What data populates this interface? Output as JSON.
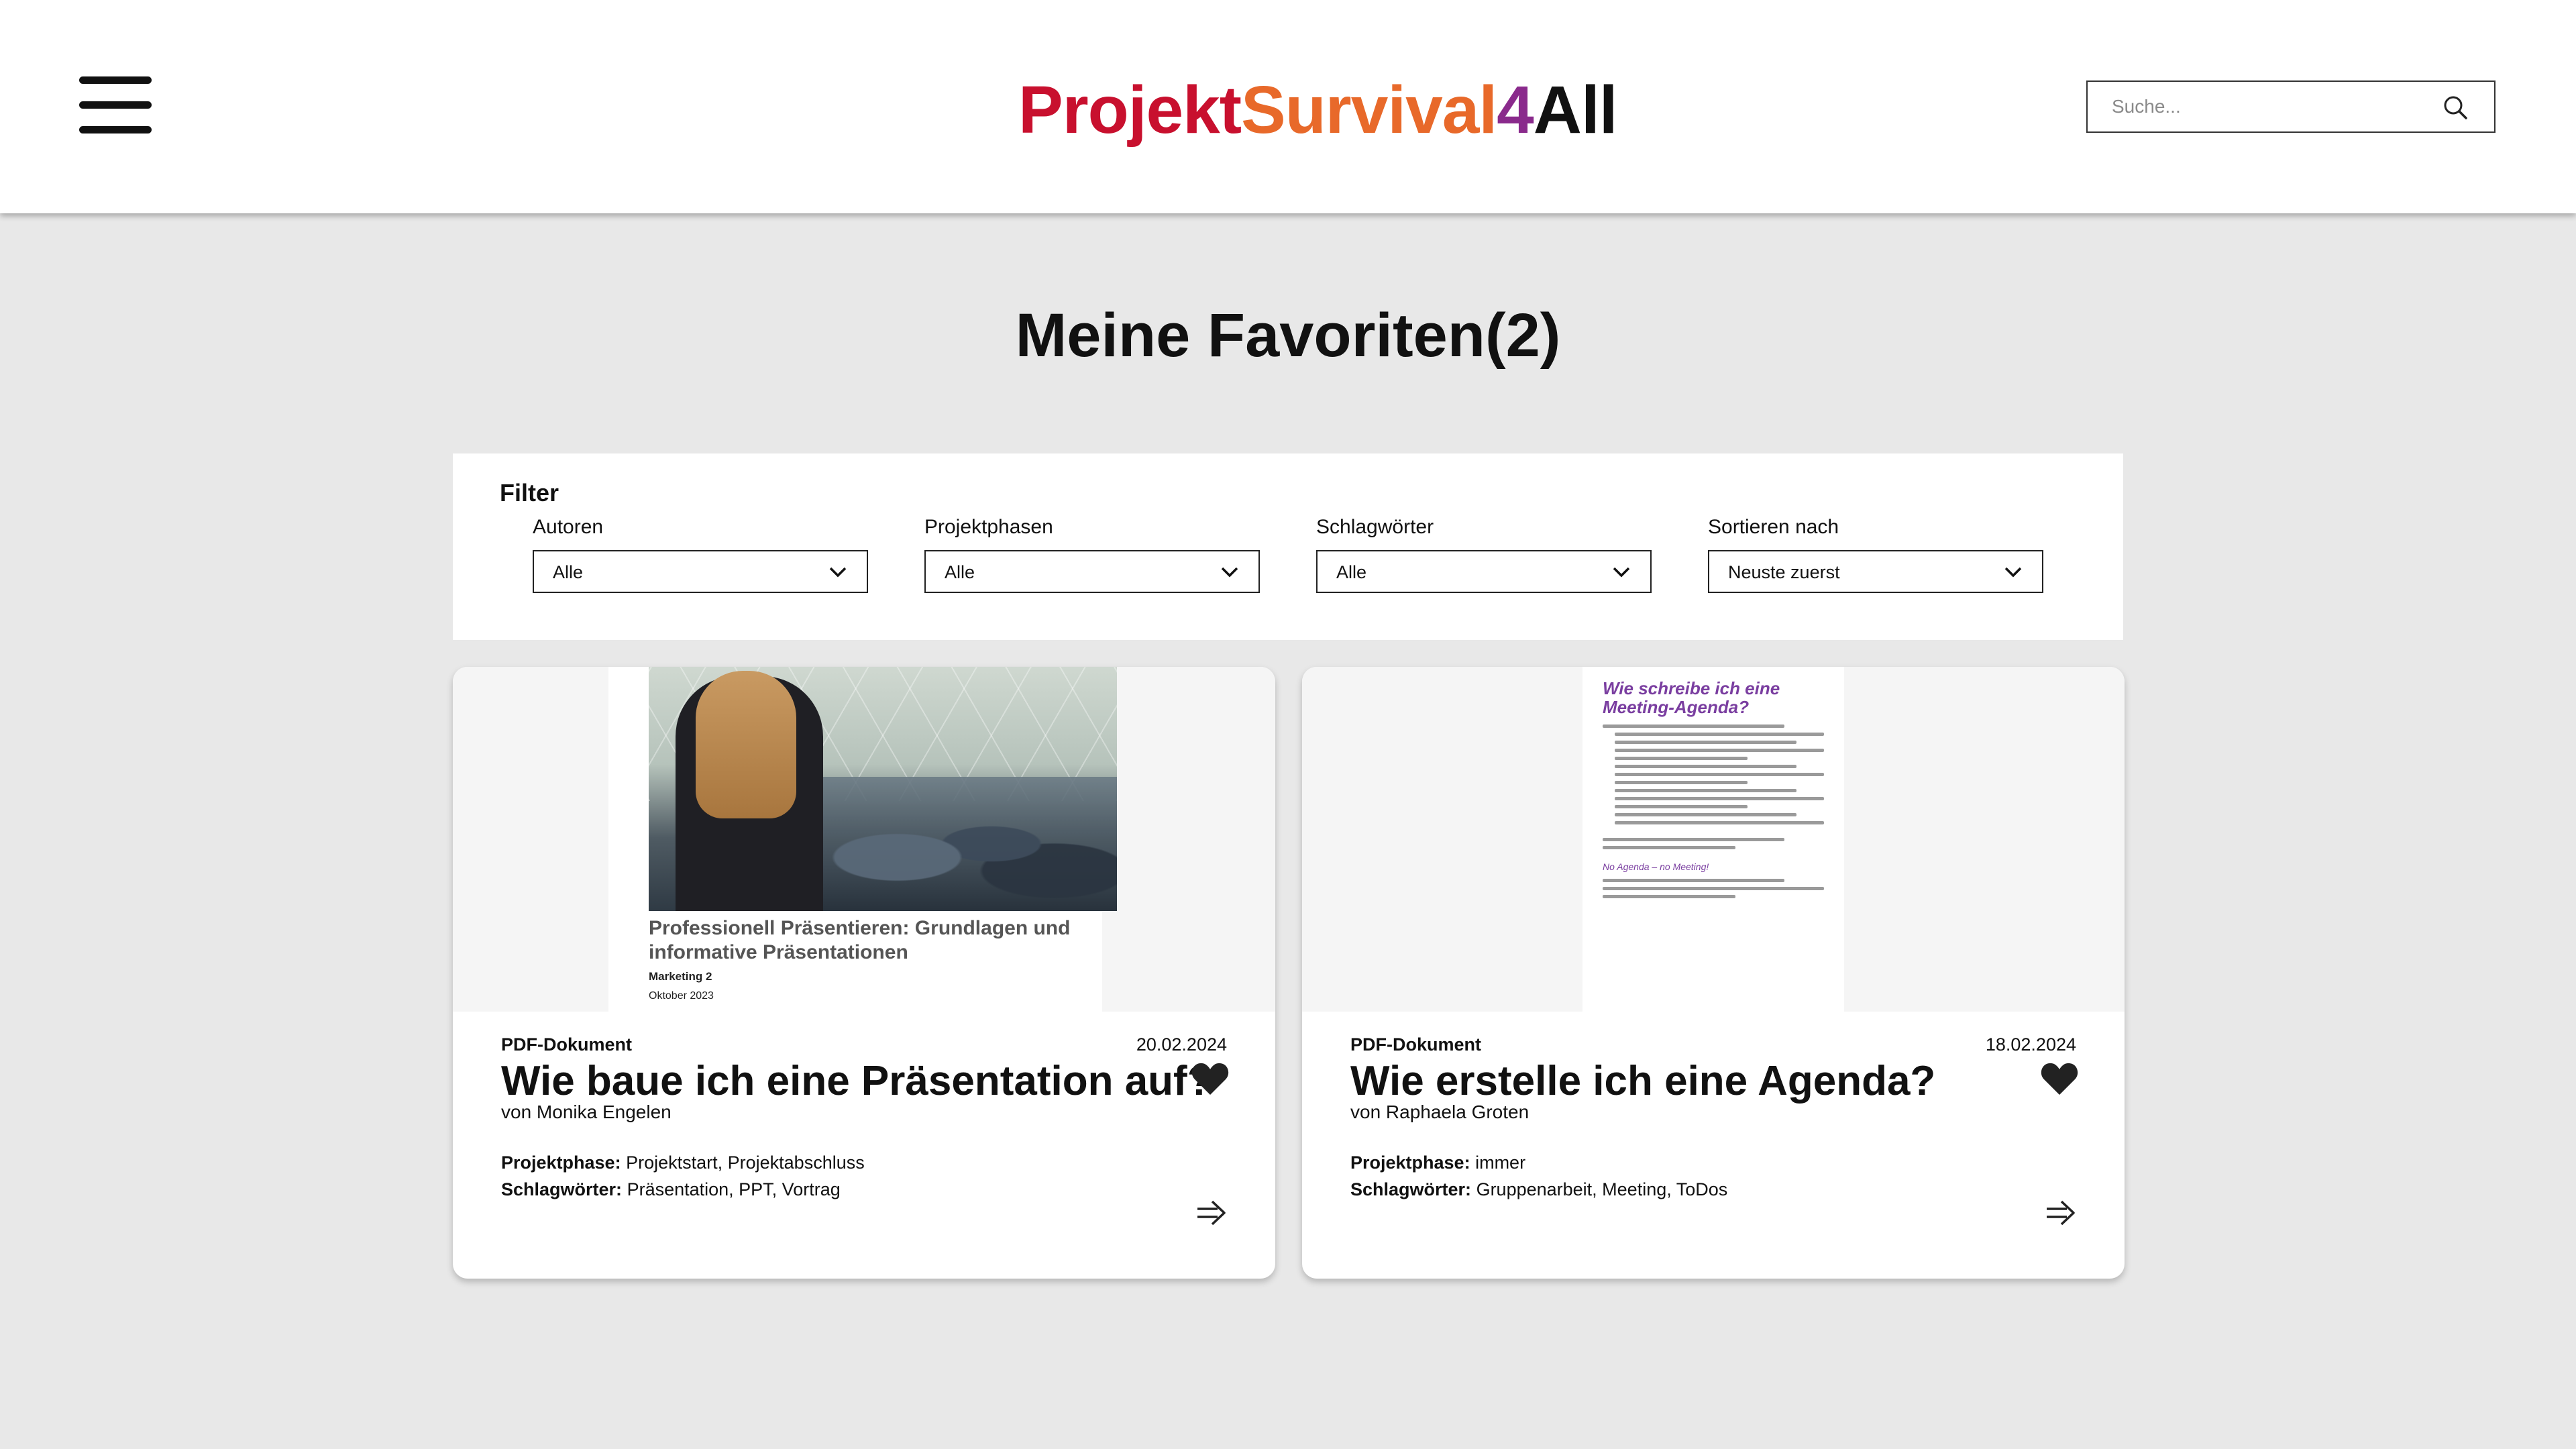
{
  "header": {
    "logo": {
      "part1": "Projekt",
      "part2": "Survival",
      "part3": "4",
      "part4": "All"
    },
    "search_placeholder": "Suche..."
  },
  "page": {
    "title": "Meine Favoriten(2)"
  },
  "filter": {
    "title": "Filter",
    "groups": [
      {
        "label": "Autoren",
        "value": "Alle"
      },
      {
        "label": "Projektphasen",
        "value": "Alle"
      },
      {
        "label": "Schlagwörter",
        "value": "Alle"
      },
      {
        "label": "Sortieren nach",
        "value": "Neuste zuerst"
      }
    ]
  },
  "cards": [
    {
      "doc_type": "PDF-Dokument",
      "date": "20.02.2024",
      "title": "Wie baue ich eine Präsentation auf?",
      "author": "von Monika Engelen",
      "phase_label": "Projektphase:",
      "phase_value": "Projektstart, Projektabschluss",
      "tags_label": "Schlagwörter:",
      "tags_value": "Präsentation, PPT, Vortrag",
      "thumb": {
        "title": "Professionell Präsentieren: Grundlagen und informative Präsentationen",
        "subtitle": "Marketing 2",
        "date": "Oktober 2023"
      }
    },
    {
      "doc_type": "PDF-Dokument",
      "date": "18.02.2024",
      "title": "Wie erstelle ich eine Agenda?",
      "author": "von Raphaela Groten",
      "phase_label": "Projektphase:",
      "phase_value": "immer",
      "tags_label": "Schlagwörter:",
      "tags_value": "Gruppenarbeit, Meeting, ToDos",
      "thumb": {
        "title": "Wie schreibe ich eine Meeting-Agenda?",
        "note": "No Agenda – no Meeting!"
      }
    }
  ],
  "colors": {
    "logo_red": "#c8102e",
    "logo_orange": "#e8692a",
    "logo_purple": "#8a2a8c",
    "background": "#e8e8e8"
  }
}
